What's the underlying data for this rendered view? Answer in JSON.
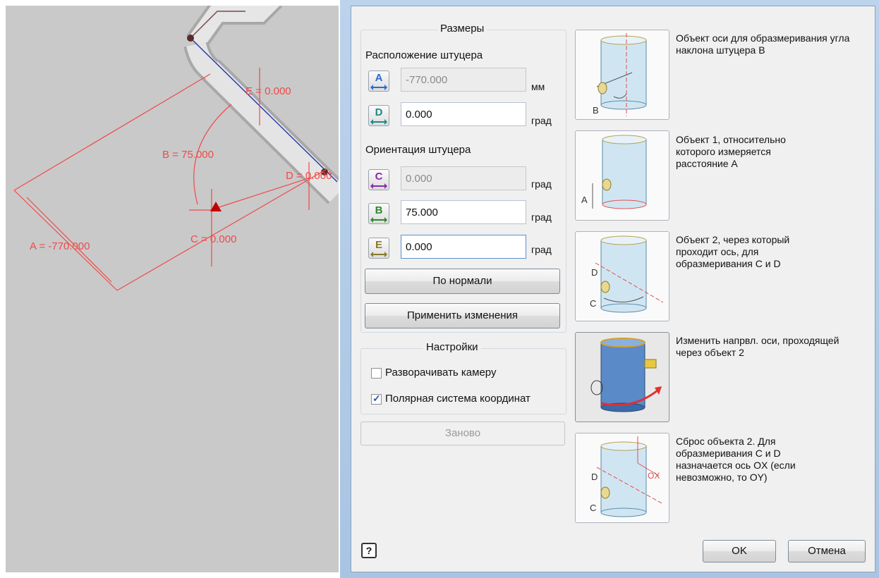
{
  "viewport": {
    "labels": {
      "a": "A = -770.000",
      "b": "B = 75.000",
      "c": "C = 0.000",
      "d": "D = 0.000",
      "e": "E = 0.000"
    }
  },
  "sizes": {
    "title": "Размеры",
    "location_heading": "Расположение штуцера",
    "fields": [
      {
        "letter": "A",
        "value": "-770.000",
        "unit": "мм",
        "enabled": false
      },
      {
        "letter": "D",
        "value": "0.000",
        "unit": "град",
        "enabled": true
      }
    ],
    "orientation_heading": "Ориентация штуцера",
    "orientation_fields": [
      {
        "letter": "C",
        "value": "0.000",
        "unit": "град",
        "enabled": false
      },
      {
        "letter": "B",
        "value": "75.000",
        "unit": "град",
        "enabled": true
      },
      {
        "letter": "E",
        "value": "0.000",
        "unit": "град",
        "enabled": true
      }
    ],
    "normal_button": "По нормали",
    "apply_button": "Применить изменения"
  },
  "settings": {
    "title": "Настройки",
    "rotate_camera": {
      "label": "Разворачивать камеру",
      "checked": false
    },
    "polar": {
      "label": "Полярная система координат",
      "checked": true
    }
  },
  "reset_button": "Заново",
  "descriptions": [
    "Объект оси для образмеривания угла наклона штуцера B",
    "Объект 1, относительно которого измеряется расстояние A",
    "Объект 2, через который проходит ось, для образмеривания  C и D",
    "Изменить напрвл. оси, проходящей через объект 2",
    "Сброс объекта 2. Для образмеривания  C и D назначается ось OX (если невозможно, то OY)"
  ],
  "illustration_labels": {
    "b": "B",
    "a": "A",
    "c": "C",
    "d": "D",
    "ox": "OX"
  },
  "footer": {
    "help": "?",
    "ok": "OK",
    "cancel": "Отмена"
  },
  "colors": {
    "dimension_red": "#f04a4a",
    "axis_blue": "#2b3bb0",
    "pipe_gray": "#d9d9d9"
  }
}
